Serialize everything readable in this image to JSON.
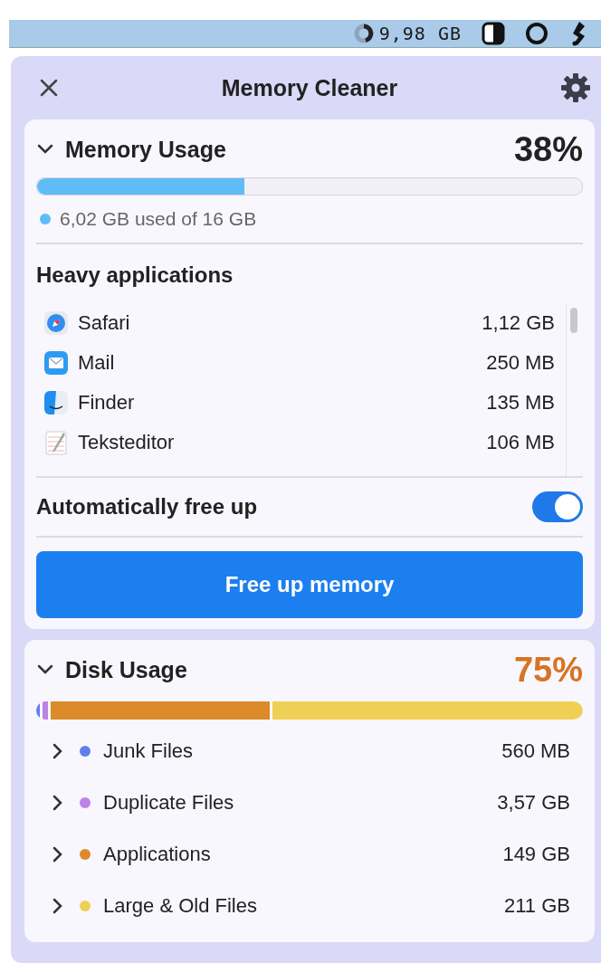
{
  "menu_bar": {
    "memory_reading": "9,98 GB"
  },
  "window": {
    "title": "Memory Cleaner"
  },
  "memory": {
    "title": "Memory Usage",
    "expanded": true,
    "percent": "38%",
    "level": 0.38,
    "summary": "6,02 GB used of 16 GB",
    "color": "#5ebcf6"
  },
  "heavy_applications": {
    "title": "Heavy applications",
    "apps": [
      {
        "name": "Safari",
        "size": "1,12 GB",
        "kind": "compass"
      },
      {
        "name": "Mail",
        "size": "250 MB",
        "kind": "mail"
      },
      {
        "name": "Finder",
        "size": "135 MB",
        "kind": "finder"
      },
      {
        "name": "Teksteditor",
        "size": "106 MB",
        "kind": "notepad"
      }
    ]
  },
  "auto_free": {
    "label": "Automatically free up",
    "on": true
  },
  "free_button": {
    "label": "Free up memory"
  },
  "disk": {
    "title": "Disk Usage",
    "expanded": true,
    "percent": "75%",
    "categories": [
      {
        "name": "Junk Files",
        "size": "560 MB",
        "color": "#5f7fec",
        "expanded": false
      },
      {
        "name": "Duplicate Files",
        "size": "3,57 GB",
        "color": "#bb82e8",
        "expanded": false
      },
      {
        "name": "Applications",
        "size": "149 GB",
        "color": "#dd8a2b",
        "expanded": false
      },
      {
        "name": "Large & Old Files",
        "size": "211 GB",
        "color": "#f0cf55",
        "expanded": false
      }
    ]
  }
}
